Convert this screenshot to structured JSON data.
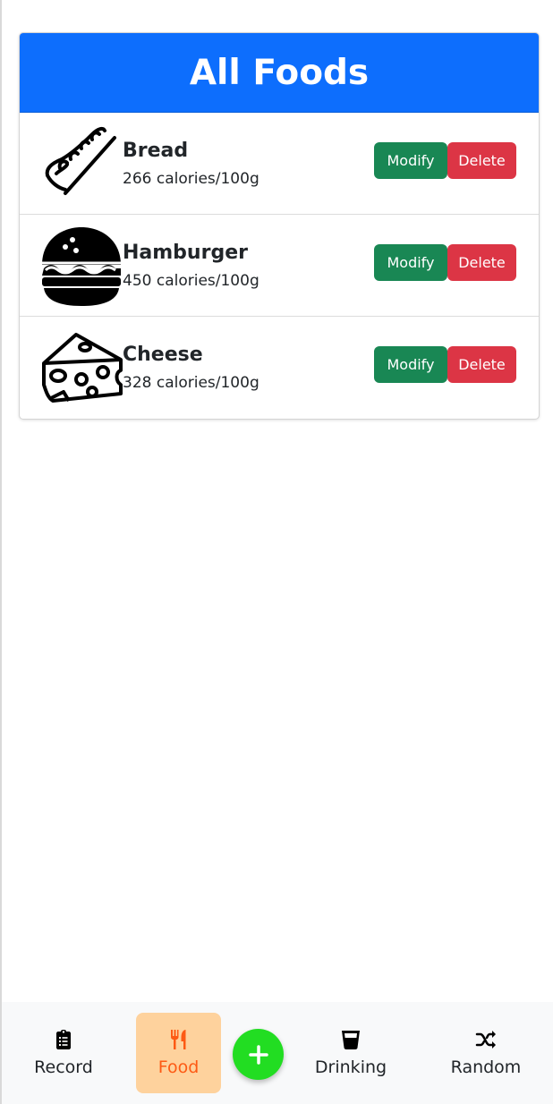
{
  "header": {
    "title": "All Foods"
  },
  "foods": [
    {
      "name": "Bread",
      "calories": "266 calories/100g",
      "icon": "bread-icon",
      "modify_label": "Modify",
      "delete_label": "Delete"
    },
    {
      "name": "Hamburger",
      "calories": "450 calories/100g",
      "icon": "hamburger-icon",
      "modify_label": "Modify",
      "delete_label": "Delete"
    },
    {
      "name": "Cheese",
      "calories": "328 calories/100g",
      "icon": "cheese-icon",
      "modify_label": "Modify",
      "delete_label": "Delete"
    }
  ],
  "nav": {
    "items": [
      {
        "label": "Record",
        "icon": "clipboard-icon"
      },
      {
        "label": "Food",
        "icon": "utensils-icon",
        "active": true
      },
      {
        "label": "Drinking",
        "icon": "glass-icon"
      },
      {
        "label": "Random",
        "icon": "shuffle-icon"
      }
    ],
    "add_icon": "plus-icon"
  },
  "colors": {
    "primary": "#0d6efd",
    "modify": "#198754",
    "delete": "#dc3545",
    "nav_active_bg": "#fed29d",
    "nav_active_text": "#fd5a14",
    "fab": "#22dd22"
  }
}
